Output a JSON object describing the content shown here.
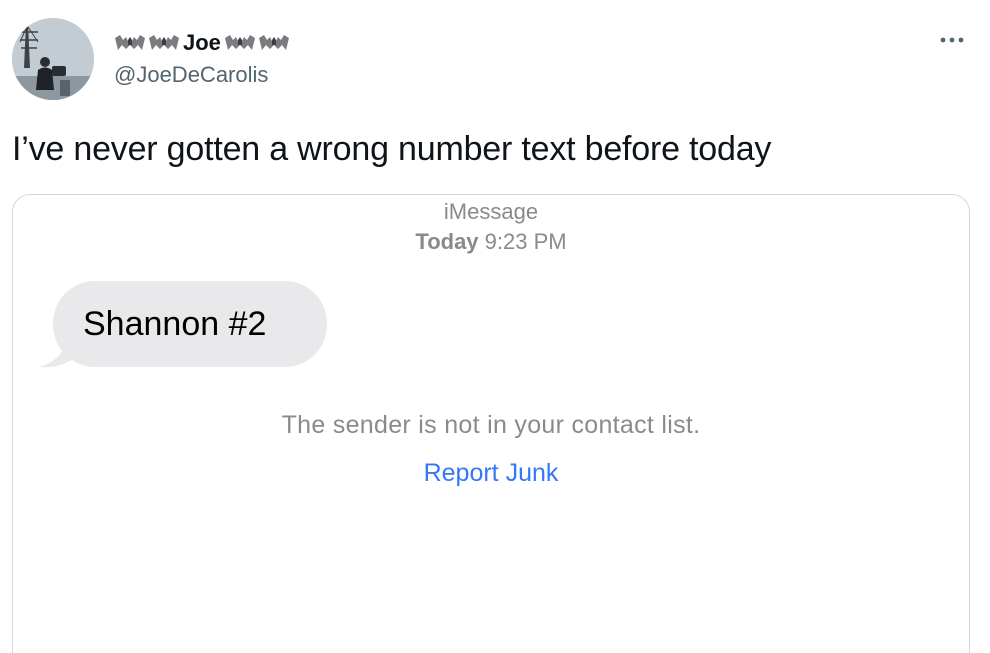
{
  "author": {
    "display_name": "Joe",
    "handle": "@JoeDeCarolis",
    "name_emoji": [
      "bat",
      "bat",
      "bat",
      "bat"
    ]
  },
  "tweet": {
    "text": "I’ve never gotten a wrong number text before today"
  },
  "icons": {
    "more": "more-horizontal-icon",
    "name_decoration": "bat-emoji-icon"
  },
  "screenshot": {
    "service": "iMessage",
    "timestamp_day": "Today",
    "timestamp_time": "9:23 PM",
    "message": "Shannon #2",
    "notice": "The sender is not in your contact list.",
    "report_label": "Report Junk"
  },
  "colors": {
    "link_blue": "#3478f6",
    "bubble_gray": "#e9e9eb",
    "meta_gray": "#8a8a8e",
    "handle_gray": "#536471"
  }
}
